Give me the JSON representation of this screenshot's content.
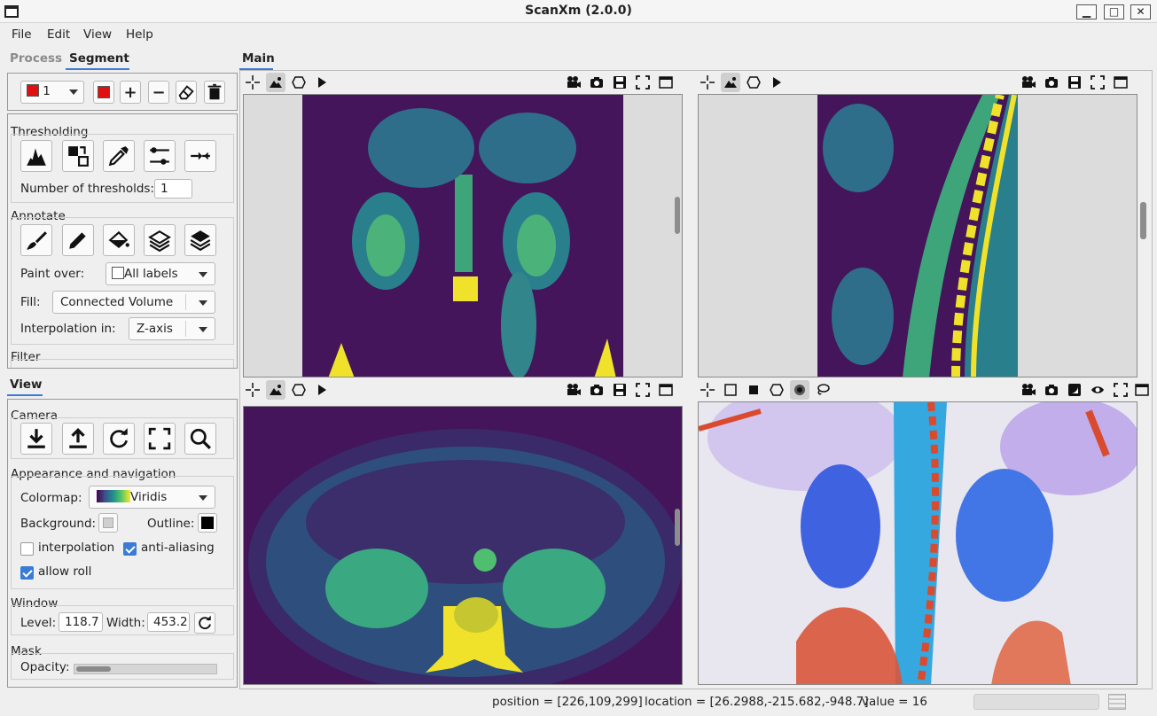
{
  "window": {
    "title": "ScanXm (2.0.0)",
    "minimize": "▁",
    "maximize": "□",
    "close": "✕"
  },
  "menu": [
    "File",
    "Edit",
    "View",
    "Help"
  ],
  "left_tabs": {
    "process": "Process",
    "segment": "Segment"
  },
  "label_selector": {
    "value": "1",
    "color": "#e01010"
  },
  "thresholding": {
    "title": "Thresholding",
    "num_label": "Number of thresholds:",
    "num_value": "1"
  },
  "annotate": {
    "title": "Annotate",
    "paint_over_label": "Paint over:",
    "paint_over_value": "All labels",
    "fill_label": "Fill:",
    "fill_value": "Connected Volume",
    "interp_label": "Interpolation in:",
    "interp_value": "Z-axis"
  },
  "filter": {
    "title": "Filter"
  },
  "view_tab": "View",
  "camera": {
    "title": "Camera"
  },
  "appearance": {
    "title": "Appearance and navigation",
    "colormap_label": "Colormap:",
    "colormap_value": "Viridis",
    "background_label": "Background:",
    "outline_label": "Outline:",
    "interpolation": "interpolation",
    "interpolation_checked": false,
    "antialiasing": "anti-aliasing",
    "antialiasing_checked": true,
    "allow_roll": "allow roll",
    "allow_roll_checked": true
  },
  "window_group": {
    "title": "Window",
    "level_label": "Level:",
    "level_value": "118.7",
    "width_label": "Width:",
    "width_value": "453.2"
  },
  "mask": {
    "title": "Mask",
    "opacity_label": "Opacity:",
    "opacity": 0.25
  },
  "main_tab": "Main",
  "status": {
    "position": "position = [226,109,299]",
    "location": "location = [26.2988,-215.682,-948.7]",
    "value": "value = 16"
  },
  "icons": {
    "slice_tools": [
      "crosshair-icon",
      "image-icon",
      "polygon-icon",
      "play-icon"
    ],
    "view_tools": [
      "video-camera-icon",
      "camera-icon",
      "save-icon",
      "fullscreen-icon",
      "window-icon"
    ]
  },
  "colors": {
    "accent": "#3a7bd5",
    "viridis_bg": "#44155a",
    "label_red": "#e01010"
  }
}
